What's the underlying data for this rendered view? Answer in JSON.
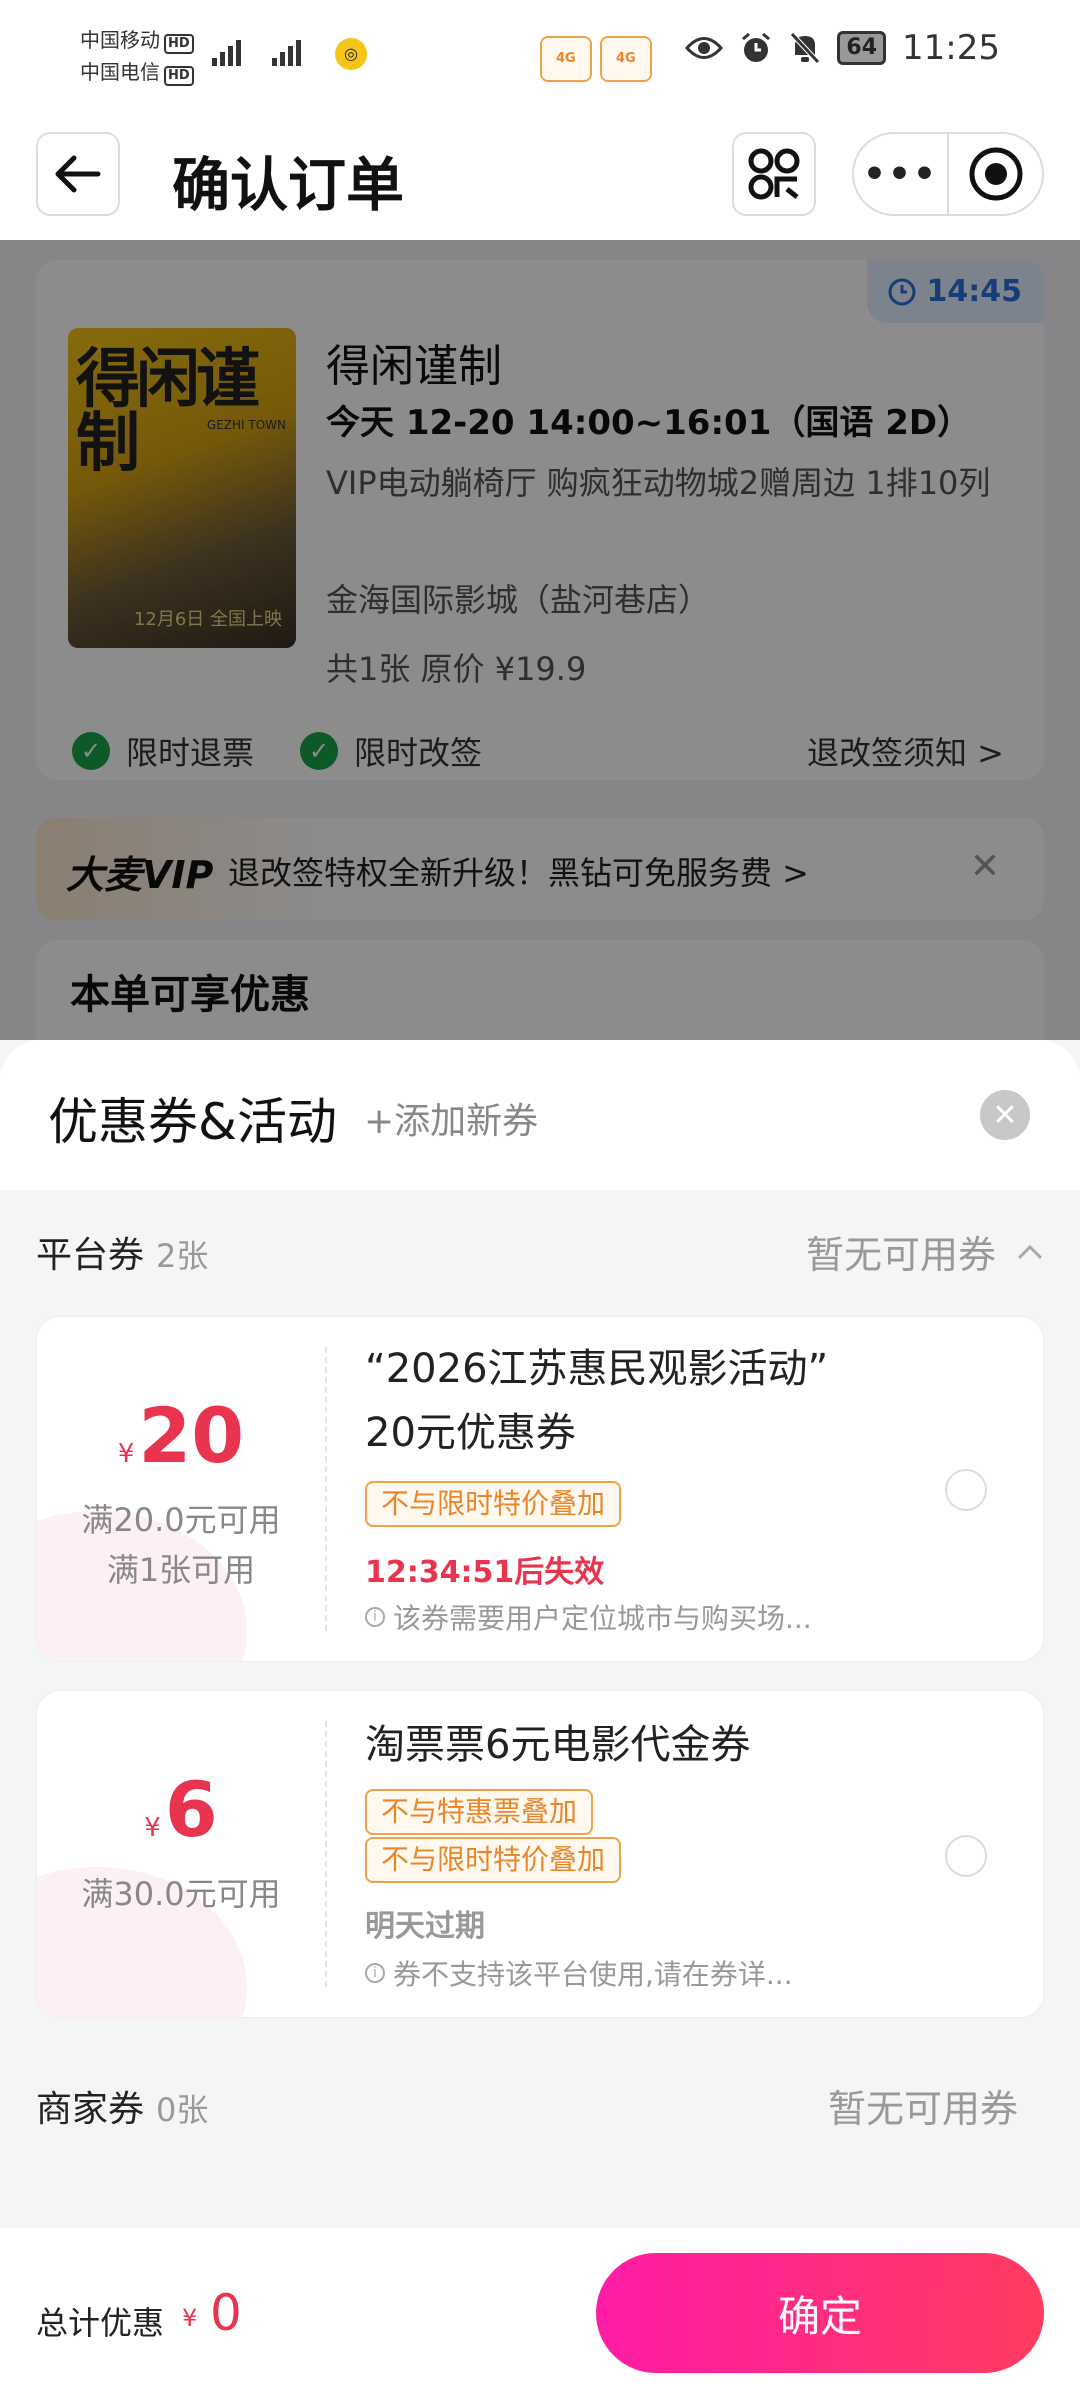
{
  "status_bar": {
    "carrier1": "中国移动",
    "carrier2": "中国电信",
    "hd": "HD",
    "net1": "4G",
    "net2": "4G",
    "battery": "64",
    "time": "11:25"
  },
  "header": {
    "title": "确认订单"
  },
  "order": {
    "timer": "14:45",
    "poster_title": "得闲谨制",
    "poster_sub": "GEZHI TOWN",
    "poster_date": "12月6日 全国上映",
    "movie_title": "得闲谨制",
    "showtime": "今天 12-20 14:00~16:01（国语 2D）",
    "hall": "VIP电动躺椅厅 购疯狂动物城2赠周边 1排10列",
    "cinema": "金海国际影城（盐河巷店）",
    "price": "共1张 原价 ¥19.9",
    "perk1": "限时退票",
    "perk2": "限时改签",
    "rules_link": "退改签须知 >"
  },
  "vip": {
    "logo": "大麦VIP",
    "text": "退改签特权全新升级！黑钻可免服务费 >"
  },
  "discount": {
    "title": "本单可享优惠"
  },
  "sheet": {
    "title": "优惠券&活动",
    "add_coupon": "+添加新券",
    "platform": {
      "label": "平台券",
      "count": "2张",
      "status": "暂无可用券"
    },
    "coupons": [
      {
        "yen": "¥",
        "amount": "20",
        "cond1": "满20.0元可用",
        "cond2": "满1张可用",
        "title_line1": "“2026江苏惠民观影活动”",
        "title_line2": "20元优惠券",
        "tags": [
          "不与限时特价叠加"
        ],
        "expire": "12:34:51后失效",
        "expire_color": "#e8344e",
        "note": "该券需要用户定位城市与购买场..."
      },
      {
        "yen": "¥",
        "amount": "6",
        "cond1": "满30.0元可用",
        "title_line1": "淘票票6元电影代金券",
        "tags": [
          "不与特惠票叠加",
          "不与限时特价叠加"
        ],
        "expire": "明天过期",
        "expire_color": "#999999",
        "note": "券不支持该平台使用,请在券详..."
      }
    ],
    "merchant": {
      "label": "商家券",
      "count": "0张",
      "status": "暂无可用券"
    }
  },
  "footer": {
    "total_label": "总计优惠",
    "yen": "¥",
    "total_value": "0",
    "confirm": "确定"
  },
  "colors": {
    "accent": "#e8344e",
    "button_gradient_start": "#ff1ca6",
    "button_gradient_end": "#ff3c5f",
    "tag_orange": "#e8862a",
    "timer_blue": "#2a6fdb",
    "check_green": "#1aa34a"
  },
  "icons": [
    "back-arrow-icon",
    "qr-scan-icon",
    "more-dots-icon",
    "target-icon",
    "clock-icon",
    "check-icon",
    "close-icon",
    "chevron-up-icon",
    "info-icon",
    "eye-icon",
    "alarm-icon",
    "mute-icon"
  ]
}
